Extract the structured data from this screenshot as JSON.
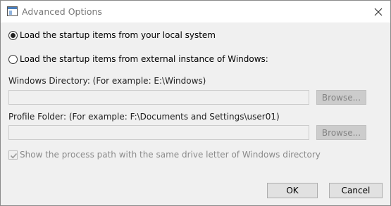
{
  "window": {
    "title": "Advanced Options"
  },
  "options": {
    "local_label": "Load the startup items from your local system",
    "external_label": "Load the startup items from external instance of Windows:"
  },
  "windows_dir": {
    "label": "Windows Directory:  (For example:  E:\\Windows)",
    "value": "",
    "browse_label": "Browse..."
  },
  "profile_folder": {
    "label": "Profile Folder:  (For example:  F:\\Documents and Settings\\user01)",
    "value": "",
    "browse_label": "Browse..."
  },
  "show_process_path": {
    "label": "Show the process path with the same drive letter of Windows directory",
    "checked": true
  },
  "buttons": {
    "ok": "OK",
    "cancel": "Cancel"
  }
}
